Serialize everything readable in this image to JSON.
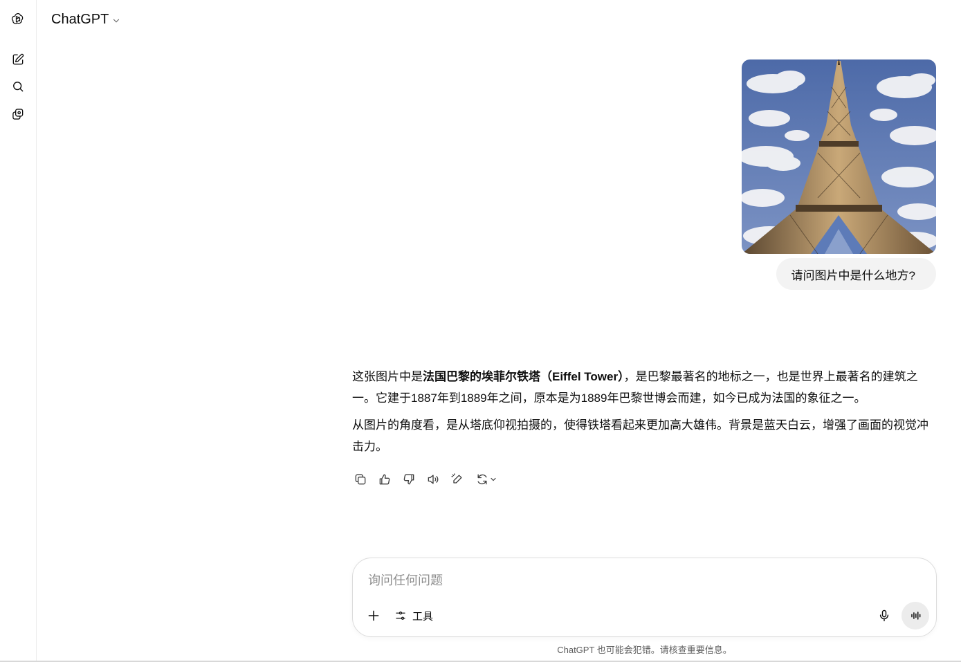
{
  "app": {
    "title": "ChatGPT"
  },
  "sidebar": {
    "icons": [
      "openai-logo-icon",
      "new-chat-icon",
      "search-icon",
      "library-icon"
    ]
  },
  "conversation": {
    "user_message": "请问图片中是什么地方?",
    "user_image_subject": "eiffel-tower-photo",
    "assistant": {
      "p1_prefix": "这张图片中是",
      "p1_bold": "法国巴黎的埃菲尔铁塔（Eiffel Tower）",
      "p1_suffix": "，是巴黎最著名的地标之一，也是世界上最著名的建筑之一。它建于1887年到1889年之间，原本是为1889年巴黎世博会而建，如今已成为法国的象征之一。",
      "p2": "从图片的角度看，是从塔底仰视拍摄的，使得铁塔看起来更加高大雄伟。背景是蓝天白云，增强了画面的视觉冲击力。"
    },
    "actions": [
      "copy-icon",
      "thumbs-up-icon",
      "thumbs-down-icon",
      "read-aloud-icon",
      "edit-canvas-icon",
      "regenerate-icon"
    ]
  },
  "composer": {
    "placeholder": "询问任何问题",
    "tools_label": "工具"
  },
  "footer": {
    "disclaimer": "ChatGPT 也可能会犯错。请核查重要信息。"
  },
  "colors": {
    "background": "#ffffff",
    "bubble": "#f3f3f3",
    "text": "#0d0d0d",
    "muted": "#5d5d5d",
    "sky": "#5a78b4"
  }
}
